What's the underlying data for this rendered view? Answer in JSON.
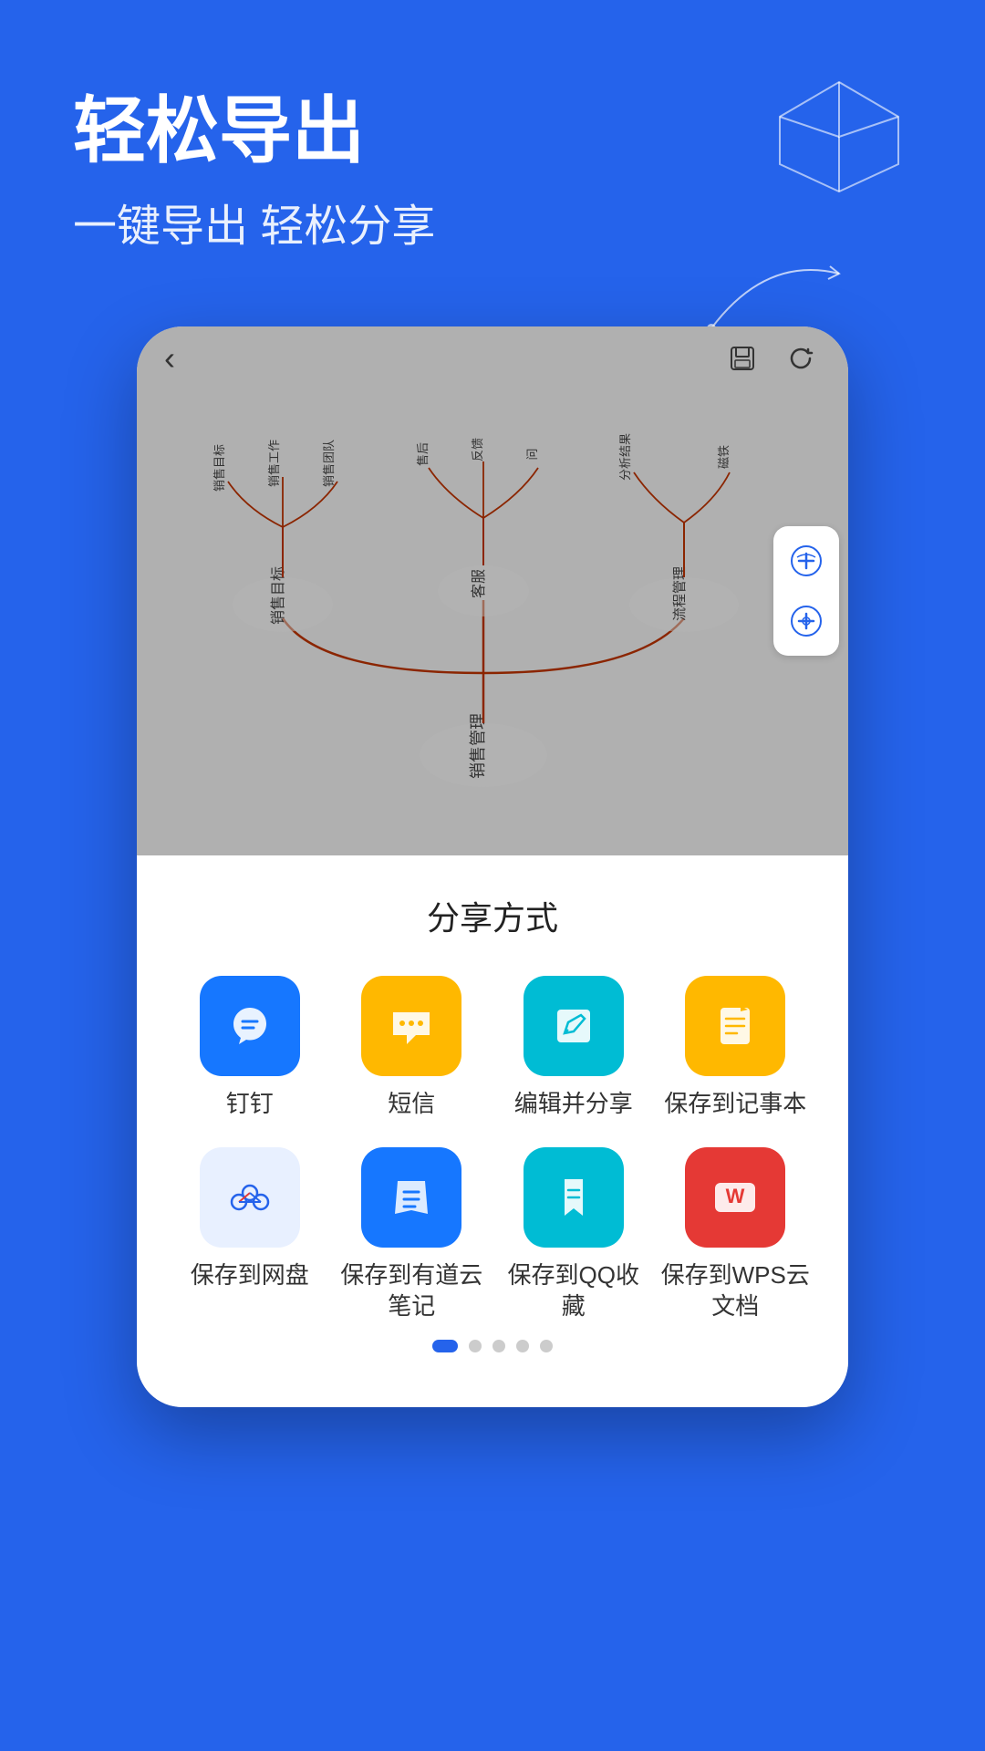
{
  "header": {
    "title": "轻松导出",
    "subtitle": "一键导出 轻松分享"
  },
  "phone": {
    "topbar": {
      "back_label": "‹",
      "save_icon": "💾",
      "refresh_icon": "↻"
    },
    "mindmap": {
      "root_label": "销售管理",
      "branch1_label": "销售目标",
      "branch1_sub1": "销售目标",
      "branch1_sub2": "销售工作",
      "branch1_sub3": "销售团队",
      "branch2_label": "客服",
      "branch2_sub1": "售后",
      "branch2_sub2": "反馈",
      "branch2_sub3": "问",
      "branch3_label": "流程管理",
      "branch3_sub1": "分析结果",
      "branch3_sub2": "磁铁"
    },
    "sidebar_btn1": "⊕",
    "sidebar_btn2": "⊕"
  },
  "share_sheet": {
    "title": "分享方式",
    "items": [
      {
        "id": "dingtalk",
        "label": "钉钉",
        "icon_class": "icon-dingtalk",
        "icon_char": "✈"
      },
      {
        "id": "sms",
        "label": "短信",
        "icon_class": "icon-sms",
        "icon_char": "✉"
      },
      {
        "id": "edit_share",
        "label": "编辑并分享",
        "icon_class": "icon-edit",
        "icon_char": "✏"
      },
      {
        "id": "notepad",
        "label": "保存到记事本",
        "icon_class": "icon-notepad",
        "icon_char": "✉"
      },
      {
        "id": "netdisk",
        "label": "保存到网盘",
        "icon_class": "icon-netdisk",
        "icon_char": "❋"
      },
      {
        "id": "youdao",
        "label": "保存到有道云笔记",
        "icon_class": "icon-youdao",
        "icon_char": "✎"
      },
      {
        "id": "qq_bookmark",
        "label": "保存到QQ收藏",
        "icon_class": "icon-qqbookmark",
        "icon_char": "🔖"
      },
      {
        "id": "wps",
        "label": "保存到WPS云文档",
        "icon_class": "icon-wps",
        "icon_char": "W"
      }
    ]
  },
  "page_dots": {
    "count": 5,
    "active_index": 0
  }
}
